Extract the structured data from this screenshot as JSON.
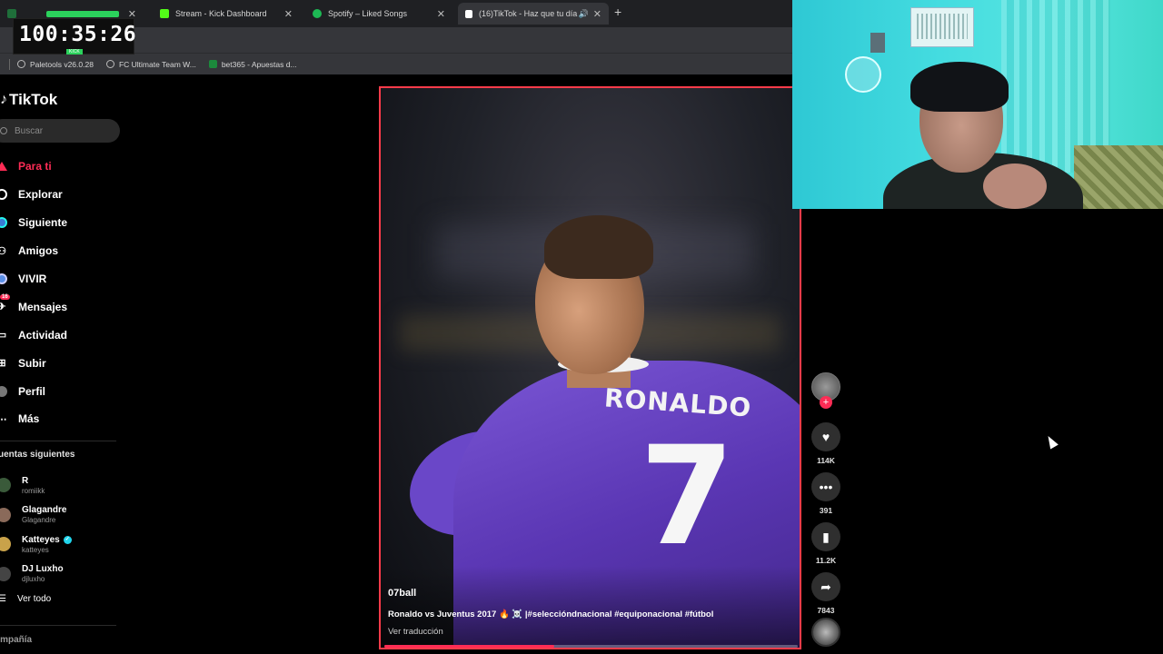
{
  "browser": {
    "tabs": [
      {
        "title": "",
        "favicon_color": "#1f6f3a"
      },
      {
        "title": "Stream - Kick Dashboard",
        "favicon_color": "#53fc18"
      },
      {
        "title": "Spotify – Liked Songs",
        "favicon_color": "#1db954"
      },
      {
        "title": "(16)TikTok - Haz que tu día",
        "favicon_color": "#ffffff"
      }
    ],
    "new_tab": "+",
    "bookmarks": [
      "Paletools v26.0.28",
      "FC Ultimate Team W...",
      "bet365 - Apuestas d..."
    ]
  },
  "timer": {
    "value": "100:35:26",
    "badge": "KICK"
  },
  "tiktok": {
    "logo": "TikTok",
    "search_placeholder": "Buscar",
    "nav": [
      {
        "label": "Para ti",
        "icon": "home-icon"
      },
      {
        "label": "Explorar",
        "icon": "compass-icon"
      },
      {
        "label": "Siguiente",
        "icon": "following-icon"
      },
      {
        "label": "Amigos",
        "icon": "friends-icon"
      },
      {
        "label": "VIVIR",
        "icon": "live-icon"
      },
      {
        "label": "Mensajes",
        "icon": "messages-icon",
        "badge": "16"
      },
      {
        "label": "Actividad",
        "icon": "activity-icon"
      },
      {
        "label": "Subir",
        "icon": "upload-icon"
      },
      {
        "label": "Perfil",
        "icon": "profile-icon"
      },
      {
        "label": "Más",
        "icon": "more-icon"
      }
    ],
    "following_title": "uentas siguientes",
    "following": [
      {
        "name": "R",
        "handle": "romiikk",
        "verified": false
      },
      {
        "name": "Glagandre",
        "handle": "Glagandre",
        "verified": false
      },
      {
        "name": "Katteyes",
        "handle": "katteyes",
        "verified": true
      },
      {
        "name": "DJ Luxho",
        "handle": "djluxho",
        "verified": false
      }
    ],
    "see_all": "Ver todo",
    "company": "ompañía"
  },
  "video": {
    "author": "07ball",
    "caption": "Ronaldo vs Juventus 2017 🔥 ☠️ |#seleccióndnacional #equiponacional #fútbol",
    "translate": "Ver traducción",
    "jersey_name": "RONALDO",
    "jersey_number": "7",
    "progress_percent": 41
  },
  "actions": {
    "likes": "114K",
    "comments": "391",
    "saves": "11.2K",
    "shares": "7843"
  },
  "colors": {
    "accent": "#fe2c55",
    "video_border": "#ff3b4a"
  }
}
